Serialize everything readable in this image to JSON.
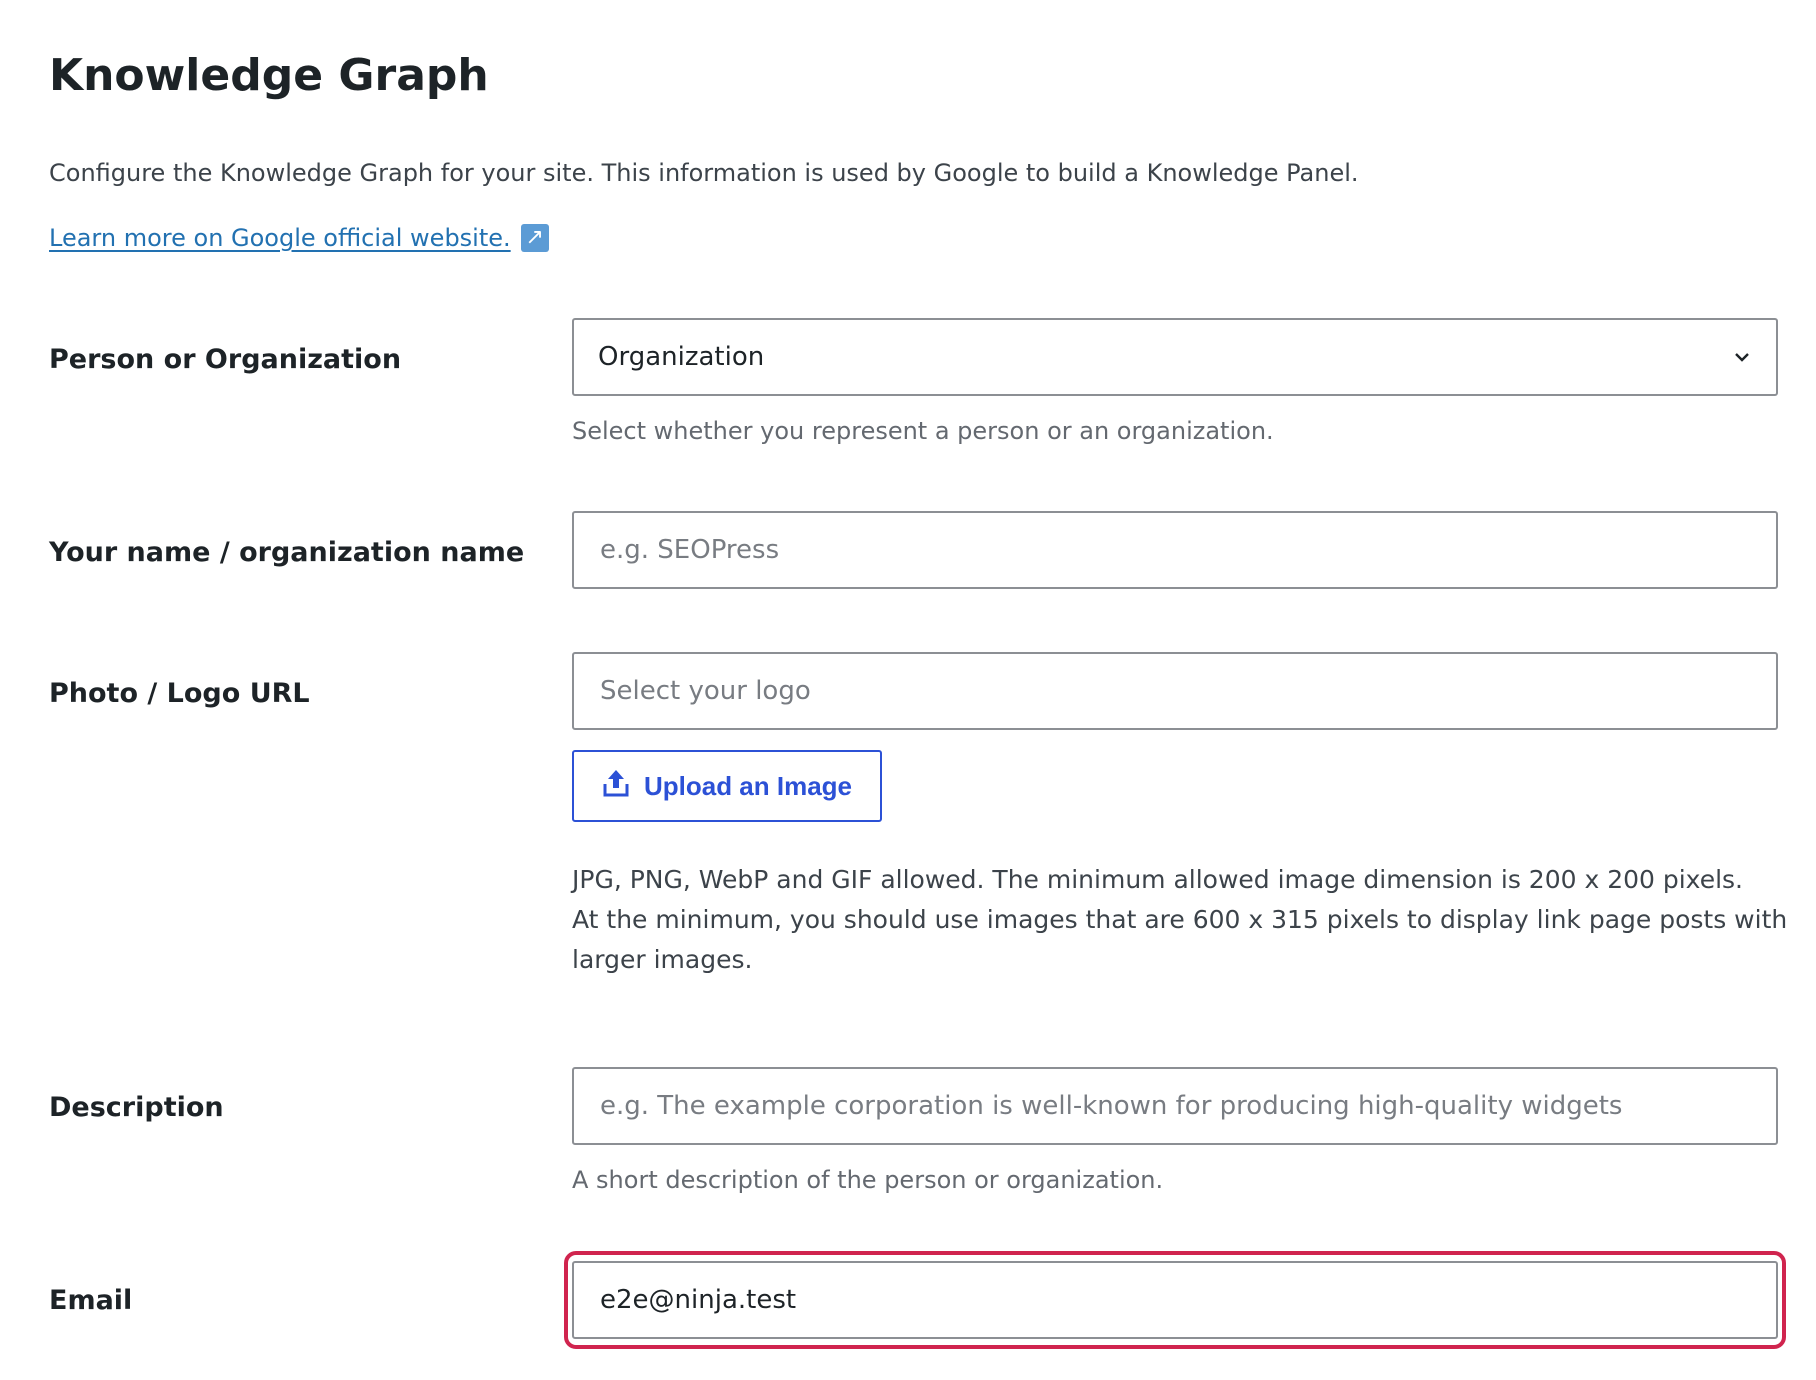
{
  "page": {
    "title": "Knowledge Graph",
    "intro": "Configure the Knowledge Graph for your site. This information is used by Google to build a Knowledge Panel.",
    "learn_more": "Learn more on Google official website.",
    "external_icon": "external-link-icon"
  },
  "fields": {
    "person_org": {
      "label": "Person or Organization",
      "value": "Organization",
      "help": "Select whether you represent a person or an organization."
    },
    "name": {
      "label": "Your name / organization name",
      "placeholder": "e.g. SEOPress",
      "value": ""
    },
    "logo": {
      "label": "Photo / Logo URL",
      "placeholder": "Select your logo",
      "value": "",
      "upload_label": "Upload an Image",
      "upload_icon": "upload-icon",
      "notice_line1": "JPG, PNG, WebP and GIF allowed. The minimum allowed image dimension is 200 x 200 pixels.",
      "notice_line2": "At the minimum, you should use images that are 600 x 315 pixels to display link page posts with larger images."
    },
    "description": {
      "label": "Description",
      "placeholder": "e.g. The example corporation is well-known for producing high-quality widgets",
      "value": "",
      "help": "A short description of the person or organization."
    },
    "email": {
      "label": "Email",
      "value": "e2e@ninja.test"
    }
  },
  "colors": {
    "link": "#2271b1",
    "button_accent": "#2c51d6",
    "highlight": "#d0244e"
  }
}
